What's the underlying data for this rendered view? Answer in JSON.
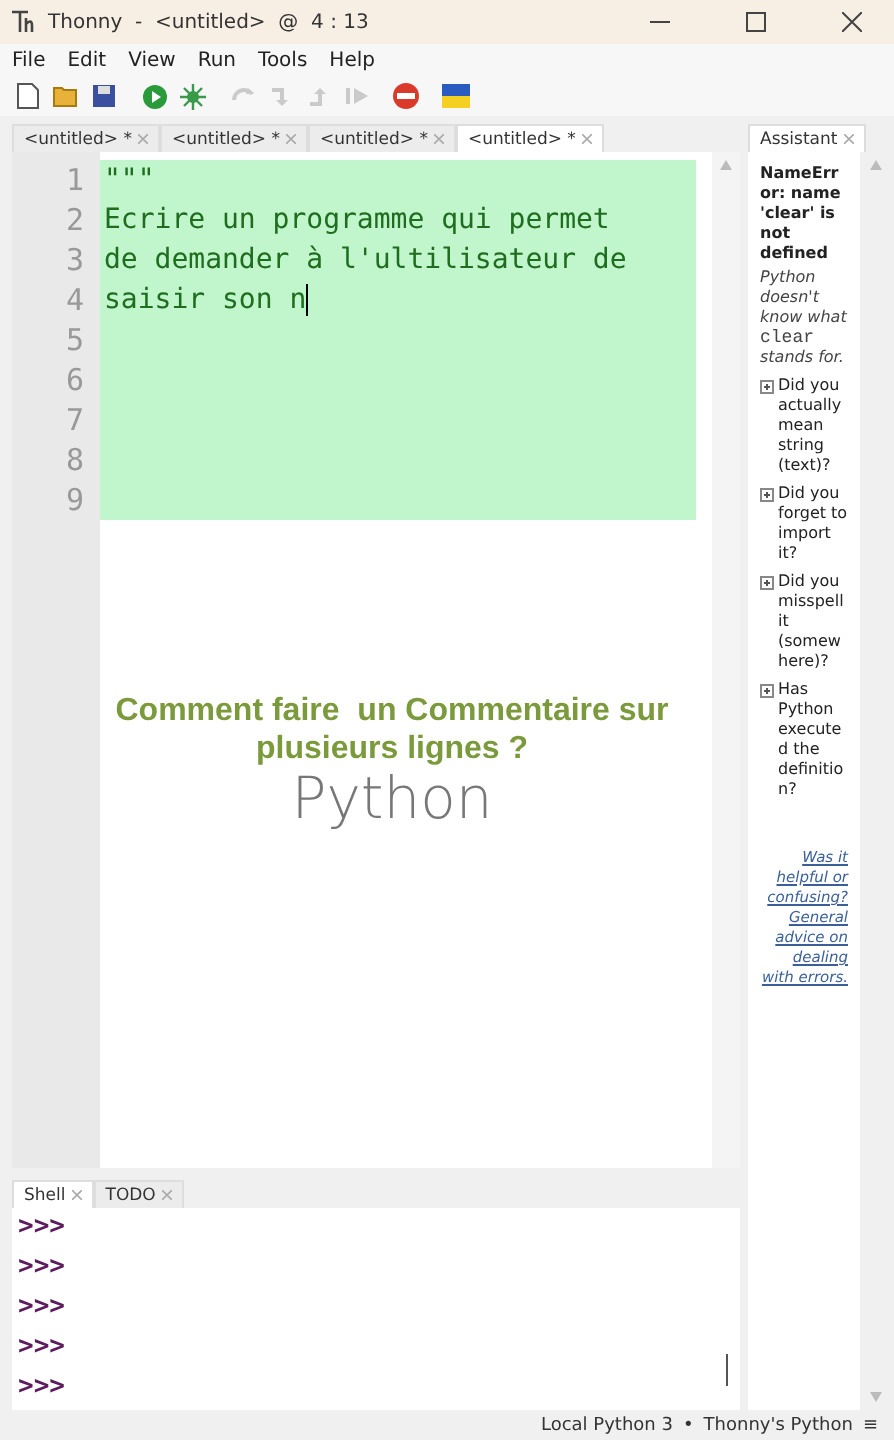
{
  "window": {
    "title": "Thonny  -  <untitled>  @  4 : 13"
  },
  "menu": [
    "File",
    "Edit",
    "View",
    "Run",
    "Tools",
    "Help"
  ],
  "toolbar": [
    {
      "kind": "new",
      "disabled": false
    },
    {
      "kind": "open",
      "disabled": false
    },
    {
      "kind": "save",
      "disabled": false
    },
    {
      "kind": "run",
      "disabled": false
    },
    {
      "kind": "debug",
      "disabled": false
    },
    {
      "kind": "step-over",
      "disabled": true
    },
    {
      "kind": "step-into",
      "disabled": true
    },
    {
      "kind": "step-out",
      "disabled": true
    },
    {
      "kind": "resume",
      "disabled": true
    },
    {
      "kind": "stop",
      "disabled": false
    },
    {
      "kind": "flag",
      "disabled": false
    }
  ],
  "editor_tabs": [
    {
      "label": "<untitled> *",
      "selected": false
    },
    {
      "label": "<untitled> *",
      "selected": false
    },
    {
      "label": "<untitled> *",
      "selected": false
    },
    {
      "label": "<untitled> *",
      "selected": true
    }
  ],
  "editor": {
    "lines": [
      {
        "number": "1",
        "text": "\"\"\"",
        "highlighted": true,
        "cursor": false
      },
      {
        "number": "2",
        "text": "Ecrire un programme qui permet",
        "highlighted": true,
        "cursor": false
      },
      {
        "number": "3",
        "text": "de demander à l'ultilisateur de",
        "highlighted": true,
        "cursor": false
      },
      {
        "number": "4",
        "text": "saisir son n",
        "highlighted": true,
        "cursor": true
      },
      {
        "number": "5",
        "highlighted": true,
        "cursor": false
      },
      {
        "number": "6",
        "highlighted": true,
        "cursor": false
      },
      {
        "number": "7",
        "highlighted": true,
        "cursor": false
      },
      {
        "number": "8",
        "highlighted": true,
        "cursor": false
      },
      {
        "number": "9",
        "highlighted": true,
        "cursor": false
      }
    ]
  },
  "overlay": {
    "title": "Comment faire  un Commentaire sur plusieurs lignes ?",
    "subtitle": "Python"
  },
  "assistant": {
    "tab": {
      "label": "Assistant",
      "selected": true
    },
    "error": "NameError: name 'clear' is not defined",
    "hint": [
      {
        "kind": "italic",
        "text": "Python doesn't know what "
      },
      {
        "kind": "code",
        "text": "clear"
      },
      {
        "kind": "italic",
        "text": " stands for."
      }
    ],
    "suggestions": [
      {
        "text": "Did you actually mean string (text)?",
        "expanded": false
      },
      {
        "text": "Did you forget to import it?",
        "expanded": false
      },
      {
        "text": "Did you misspell it (somewhere)?",
        "expanded": false
      },
      {
        "text": "Has Python executed the definition?",
        "expanded": false
      }
    ],
    "links": [
      "Was it helpful or confusing?",
      "General advice on dealing with errors."
    ]
  },
  "shell": {
    "tabs": [
      {
        "label": "Shell",
        "selected": true
      },
      {
        "label": "TODO",
        "selected": false
      }
    ],
    "prompts": [
      ">>>",
      ">>>",
      ">>>",
      ">>>",
      ">>>"
    ]
  },
  "status_bar": {
    "interpreter": "Local Python 3",
    "separator": "•",
    "python": "Thonny's Python",
    "menu": "≡"
  }
}
